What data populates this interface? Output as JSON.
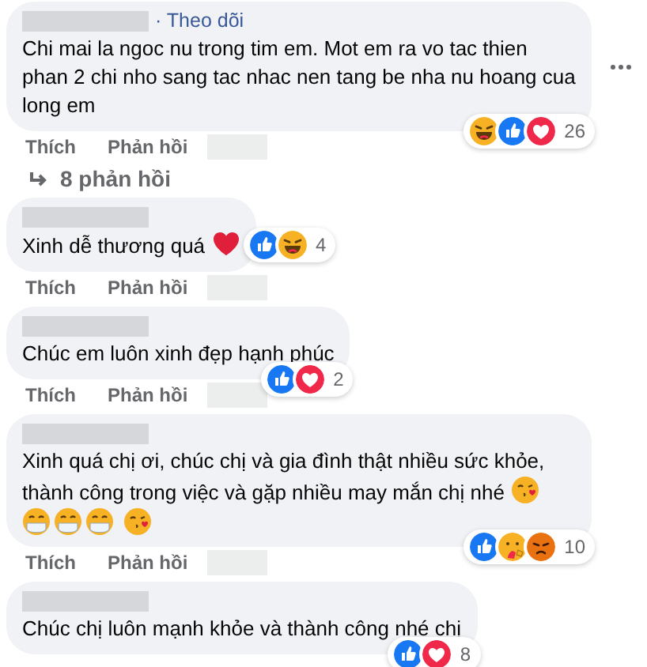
{
  "comments": [
    {
      "follow": "· Theo dõi",
      "text": "Chi mai la ngoc nu trong tim em. Mot em ra vo tac thien phan 2 chi nho sang tac nhac nen tang be nha nu hoang cua long em",
      "reactions": [
        {
          "kind": "haha"
        },
        {
          "kind": "like"
        },
        {
          "kind": "love"
        }
      ],
      "count": "26",
      "more": true,
      "inline_reactions": false,
      "actions": [
        "Thích",
        "Phản hồi"
      ],
      "replies": "8 phản hồi"
    },
    {
      "text": "Xinh dễ thương quá",
      "emojis": [
        {
          "kind": "heart"
        }
      ],
      "reactions": [
        {
          "kind": "like"
        },
        {
          "kind": "haha"
        }
      ],
      "count": "4",
      "inline_reactions": true,
      "actions": [
        "Thích",
        "Phản hồi"
      ]
    },
    {
      "text": "Chúc em luôn xinh đẹp hạnh phúc",
      "reactions": [
        {
          "kind": "like"
        },
        {
          "kind": "love"
        }
      ],
      "count": "2",
      "inline_reactions": false,
      "actions": [
        "Thích",
        "Phản hồi"
      ]
    },
    {
      "text": "Xinh quá chị ơi, chúc chị và gia đình thật nhiều sức khỏe, thành công trong việc và gặp nhiều may mắn chị nhé",
      "emojis": [
        {
          "kind": "kiss"
        }
      ],
      "emoji_line": [
        {
          "kind": "mask"
        },
        {
          "kind": "mask"
        },
        {
          "kind": "mask"
        },
        {
          "kind": "kiss"
        }
      ],
      "reactions": [
        {
          "kind": "like"
        },
        {
          "kind": "care"
        },
        {
          "kind": "angry"
        }
      ],
      "count": "10",
      "inline_reactions": false,
      "actions": [
        "Thích",
        "Phản hồi"
      ]
    },
    {
      "text": "Chúc chị luôn mạnh khỏe và thành công nhé chị",
      "reactions": [
        {
          "kind": "like"
        },
        {
          "kind": "love"
        }
      ],
      "count": "8",
      "inline_reactions": false
    }
  ]
}
